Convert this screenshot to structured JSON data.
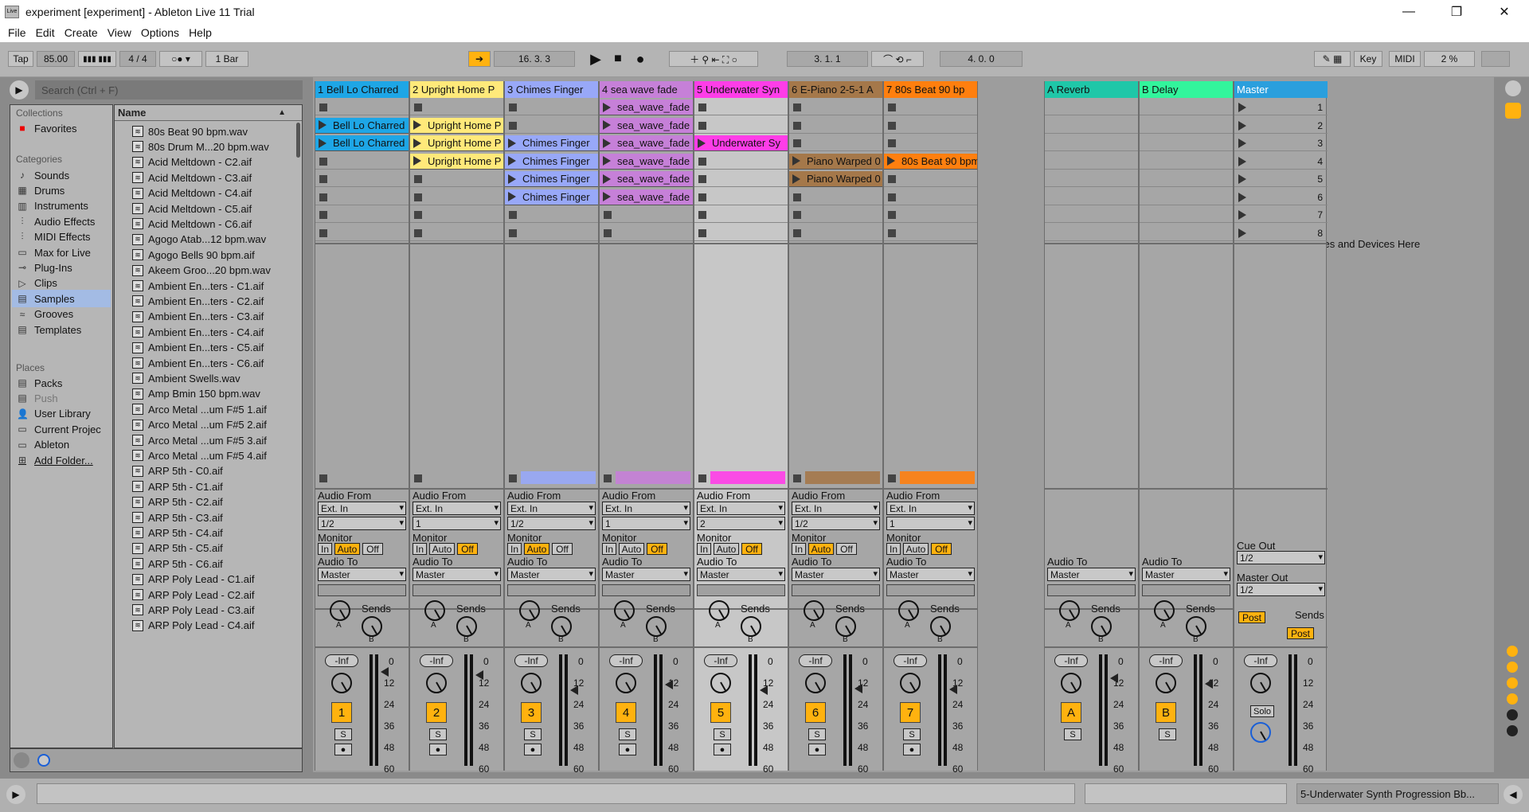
{
  "window": {
    "title": "experiment  [experiment] - Ableton Live 11 Trial",
    "icon_text": "Live",
    "min": "—",
    "max": "❐",
    "close": "✕"
  },
  "menu": [
    "File",
    "Edit",
    "Create",
    "View",
    "Options",
    "Help"
  ],
  "control": {
    "tap": "Tap",
    "tempo": "85.00",
    "sig": "4 / 4",
    "quant": "1 Bar",
    "position": "16.  3.  3",
    "loop_start": "3.  1.  1",
    "loop_len": "4.  0.  0",
    "key": "Key",
    "midi": "MIDI",
    "cpu": "2 %"
  },
  "browser": {
    "search_placeholder": "Search (Ctrl + F)",
    "collections_hdr": "Collections",
    "favorites": "Favorites",
    "categories_hdr": "Categories",
    "categories": [
      "Sounds",
      "Drums",
      "Instruments",
      "Audio Effects",
      "MIDI Effects",
      "Max for Live",
      "Plug-Ins",
      "Clips",
      "Samples",
      "Grooves",
      "Templates"
    ],
    "places_hdr": "Places",
    "places": [
      "Packs",
      "Push",
      "User Library",
      "Current Projec",
      "Ableton",
      "Add Folder..."
    ],
    "name_hdr": "Name",
    "files": [
      "80s Beat 90 bpm.wav",
      "80s Drum M...20 bpm.wav",
      "Acid Meltdown - C2.aif",
      "Acid Meltdown - C3.aif",
      "Acid Meltdown - C4.aif",
      "Acid Meltdown - C5.aif",
      "Acid Meltdown - C6.aif",
      "Agogo Atab...12 bpm.wav",
      "Agogo Bells 90 bpm.aif",
      "Akeem Groo...20 bpm.wav",
      "Ambient En...ters - C1.aif",
      "Ambient En...ters - C2.aif",
      "Ambient En...ters - C3.aif",
      "Ambient En...ters - C4.aif",
      "Ambient En...ters - C5.aif",
      "Ambient En...ters - C6.aif",
      "Ambient Swells.wav",
      "Amp Bmin 150 bpm.wav",
      "Arco Metal ...um F#5 1.aif",
      "Arco Metal ...um F#5 2.aif",
      "Arco Metal ...um F#5 3.aif",
      "Arco Metal ...um F#5 4.aif",
      "ARP 5th - C0.aif",
      "ARP 5th - C1.aif",
      "ARP 5th - C2.aif",
      "ARP 5th - C3.aif",
      "ARP 5th - C4.aif",
      "ARP 5th - C5.aif",
      "ARP 5th - C6.aif",
      "ARP Poly Lead - C1.aif",
      "ARP Poly Lead - C2.aif",
      "ARP Poly Lead - C3.aif",
      "ARP Poly Lead - C4.aif"
    ]
  },
  "labels": {
    "audio_from": "Audio From",
    "monitor": "Monitor",
    "audio_to": "Audio To",
    "sends": "Sends",
    "in": "In",
    "auto": "Auto",
    "off": "Off",
    "inf": "-Inf",
    "s": "S",
    "a": "A",
    "b": "B",
    "post": "Post",
    "solo": "Solo",
    "cue_out": "Cue Out",
    "master_out": "Master Out"
  },
  "scale": [
    "0",
    "12",
    "24",
    "36",
    "48",
    "60"
  ],
  "drop_text": "Drop Files and Devices Here",
  "tracks": [
    {
      "name": "1 Bell Lo Charred",
      "color": "#1ea6e6",
      "num": "1",
      "input": "Ext. In",
      "chan": "1/2",
      "monitor": "auto",
      "clips": [
        {
          "slot": 1,
          "name": "Bell Lo Charred"
        },
        {
          "slot": 2,
          "name": "Bell Lo Charred"
        }
      ]
    },
    {
      "name": "2 Upright Home P",
      "color": "#ffe97a",
      "num": "2",
      "input": "Ext. In",
      "chan": "1",
      "monitor": "off",
      "clips": [
        {
          "slot": 1,
          "name": "Upright Home P"
        },
        {
          "slot": 2,
          "name": "Upright Home P"
        },
        {
          "slot": 3,
          "name": "Upright Home P"
        }
      ]
    },
    {
      "name": "3 Chimes Finger",
      "color": "#98a8f8",
      "num": "3",
      "input": "Ext. In",
      "chan": "1/2",
      "monitor": "auto",
      "clips": [
        {
          "slot": 2,
          "name": "Chimes Finger"
        },
        {
          "slot": 3,
          "name": "Chimes Finger"
        },
        {
          "slot": 4,
          "name": "Chimes Finger"
        },
        {
          "slot": 5,
          "name": "Chimes Finger"
        }
      ]
    },
    {
      "name": "4 sea  wave  fade",
      "color": "#c680d8",
      "num": "4",
      "input": "Ext. In",
      "chan": "1",
      "monitor": "off",
      "clips": [
        {
          "slot": 0,
          "name": "sea_wave_fade"
        },
        {
          "slot": 1,
          "name": "sea_wave_fade"
        },
        {
          "slot": 2,
          "name": "sea_wave_fade"
        },
        {
          "slot": 3,
          "name": "sea_wave_fade"
        },
        {
          "slot": 4,
          "name": "sea_wave_fade"
        },
        {
          "slot": 5,
          "name": "sea_wave_fade"
        }
      ]
    },
    {
      "name": "5 Underwater Syn",
      "color": "#ff3de8",
      "num": "5",
      "input": "Ext. In",
      "chan": "2",
      "monitor": "off",
      "clips": [
        {
          "slot": 2,
          "name": "Underwater Sy"
        }
      ]
    },
    {
      "name": "6 E-Piano 2-5-1 A",
      "color": "#a5784a",
      "num": "6",
      "input": "Ext. In",
      "chan": "1/2",
      "monitor": "auto",
      "clips": [
        {
          "slot": 3,
          "name": "Piano Warped 0"
        },
        {
          "slot": 4,
          "name": "Piano Warped 0"
        }
      ]
    },
    {
      "name": "7 80s Beat 90 bp",
      "color": "#ff7f0f",
      "num": "7",
      "input": "Ext. In",
      "chan": "1",
      "monitor": "off",
      "clips": [
        {
          "slot": 3,
          "name": "80s Beat 90 bpm"
        }
      ]
    }
  ],
  "returns": [
    {
      "name": "A Reverb",
      "color": "#1fc7a8",
      "num": "A"
    },
    {
      "name": "B Delay",
      "color": "#32f59c",
      "num": "B"
    }
  ],
  "master": {
    "name": "Master",
    "color": "#2a9fdd",
    "scenes": [
      "1",
      "2",
      "3",
      "4",
      "5",
      "6",
      "7",
      "8"
    ],
    "cue": "1/2",
    "out": "1/2"
  },
  "audio_to_value": "Master",
  "status_text": "5-Underwater Synth Progression Bb..."
}
